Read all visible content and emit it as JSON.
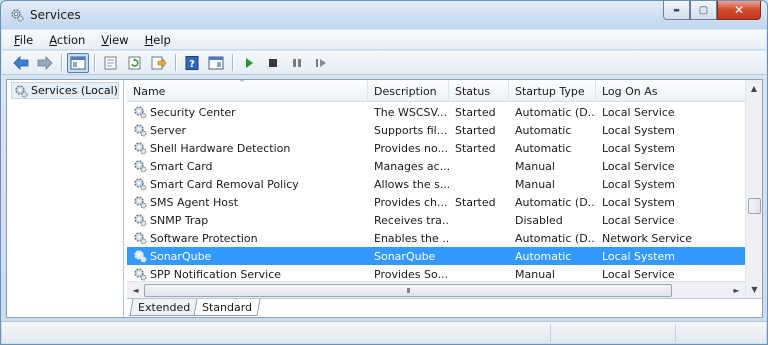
{
  "window": {
    "title": "Services",
    "ghost_title": "",
    "minimize_label": "▬",
    "maximize_label": "▢",
    "close_label": "✕"
  },
  "menu": [
    {
      "label": "File",
      "accel": "F",
      "rest": "ile"
    },
    {
      "label": "Action",
      "accel": "A",
      "rest": "ction"
    },
    {
      "label": "View",
      "accel": "V",
      "rest": "iew"
    },
    {
      "label": "Help",
      "accel": "H",
      "rest": "elp"
    }
  ],
  "toolbar": {
    "icons": [
      "back-arrow-icon",
      "forward-arrow-icon",
      "show-hide-console-tree-icon",
      "properties-icon",
      "refresh-icon",
      "export-list-icon",
      "help-icon",
      "show-hide-action-pane-icon",
      "start-service-icon",
      "stop-service-icon",
      "pause-service-icon",
      "restart-service-icon"
    ]
  },
  "tree": {
    "root_label": "Services (Local)"
  },
  "table": {
    "columns": [
      "Name",
      "Description",
      "Status",
      "Startup Type",
      "Log On As"
    ],
    "sort_indicator": "^",
    "rows": [
      {
        "name": "Security Center",
        "description": "The WSCSV...",
        "status": "Started",
        "startup": "Automatic (D...",
        "logon": "Local Service",
        "selected": false
      },
      {
        "name": "Server",
        "description": "Supports fil...",
        "status": "Started",
        "startup": "Automatic",
        "logon": "Local System",
        "selected": false
      },
      {
        "name": "Shell Hardware Detection",
        "description": "Provides no...",
        "status": "Started",
        "startup": "Automatic",
        "logon": "Local System",
        "selected": false
      },
      {
        "name": "Smart Card",
        "description": "Manages ac...",
        "status": "",
        "startup": "Manual",
        "logon": "Local Service",
        "selected": false
      },
      {
        "name": "Smart Card Removal Policy",
        "description": "Allows the s...",
        "status": "",
        "startup": "Manual",
        "logon": "Local System",
        "selected": false
      },
      {
        "name": "SMS Agent Host",
        "description": "Provides ch...",
        "status": "Started",
        "startup": "Automatic (D...",
        "logon": "Local System",
        "selected": false
      },
      {
        "name": "SNMP Trap",
        "description": "Receives tra...",
        "status": "",
        "startup": "Disabled",
        "logon": "Local Service",
        "selected": false
      },
      {
        "name": "Software Protection",
        "description": "Enables the ...",
        "status": "",
        "startup": "Automatic (D...",
        "logon": "Network Service",
        "selected": false
      },
      {
        "name": "SonarQube",
        "description": "SonarQube",
        "status": "",
        "startup": "Automatic",
        "logon": "Local System",
        "selected": true
      },
      {
        "name": "SPP Notification Service",
        "description": "Provides So...",
        "status": "",
        "startup": "Manual",
        "logon": "Local Service",
        "selected": false
      }
    ]
  },
  "scroll": {
    "up": "▲",
    "down": "▼",
    "left": "◄",
    "right": "►",
    "grip": "III"
  },
  "tabs": [
    {
      "label": "Extended",
      "active": false
    },
    {
      "label": "Standard",
      "active": true
    }
  ],
  "colors": {
    "selection": "#3399ff",
    "start_icon": "#1e9a2e"
  }
}
